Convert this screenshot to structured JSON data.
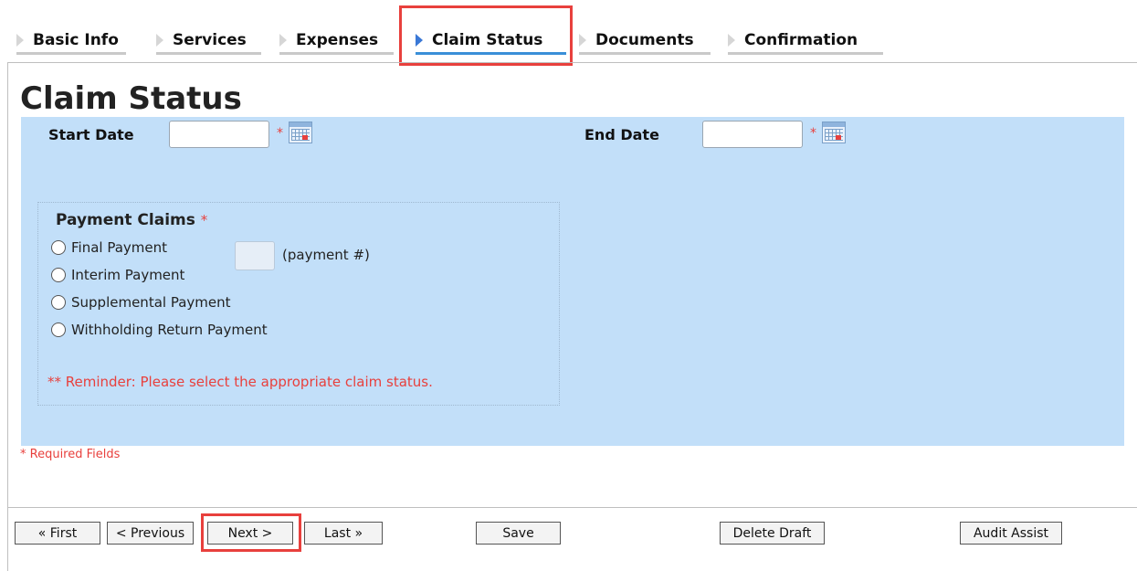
{
  "tabs": [
    {
      "label": "Basic Info",
      "active": false
    },
    {
      "label": "Services",
      "active": false
    },
    {
      "label": "Expenses",
      "active": false
    },
    {
      "label": "Claim Status",
      "active": true
    },
    {
      "label": "Documents",
      "active": false
    },
    {
      "label": "Confirmation",
      "active": false
    }
  ],
  "page_title": "Claim Status",
  "form": {
    "start_date_label": "Start Date",
    "start_date_value": "",
    "end_date_label": "End Date",
    "end_date_value": "",
    "required_marker": "*"
  },
  "payment_claims": {
    "title": "Payment Claims",
    "required_marker": "*",
    "options": [
      {
        "label": "Final Payment",
        "selected": false
      },
      {
        "label": "Interim Payment",
        "selected": false
      },
      {
        "label": "Supplemental Payment",
        "selected": false
      },
      {
        "label": "Withholding Return Payment",
        "selected": false
      }
    ],
    "payment_number_value": "",
    "payment_number_label": "(payment #)",
    "reminder": "** Reminder: Please select the appropriate claim status."
  },
  "required_fields_note": "* Required Fields",
  "buttons": {
    "first": "« First",
    "previous": "< Previous",
    "next": "Next >",
    "last": "Last »",
    "save": "Save",
    "delete_draft": "Delete Draft",
    "audit_assist": "Audit Assist"
  },
  "colors": {
    "panel_bg": "#c2dff9",
    "active_tab_underline": "#3a8fd8",
    "required_red": "#e8403d",
    "highlight_red": "#e8403d"
  },
  "icons": {
    "tab_arrow": "triangle-right-icon",
    "calendar": "calendar-icon"
  }
}
